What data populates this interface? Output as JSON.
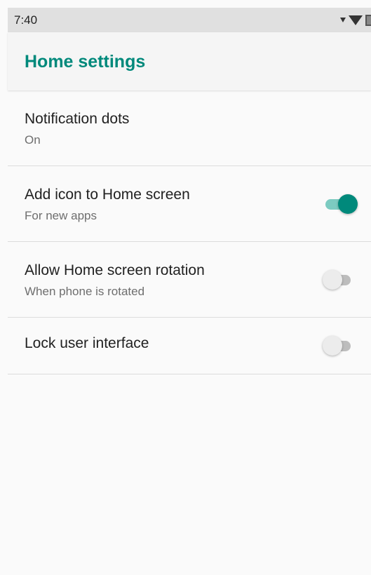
{
  "status_bar": {
    "time": "7:40",
    "icons": [
      "signal-icon",
      "wifi-icon",
      "battery-icon"
    ]
  },
  "app_bar": {
    "title": "Home settings"
  },
  "settings": [
    {
      "title": "Notification dots",
      "summary": "On"
    },
    {
      "title": "Add icon to Home screen",
      "summary": "For new apps",
      "toggle": true
    },
    {
      "title": "Allow Home screen rotation",
      "summary": "When phone is rotated",
      "toggle": false
    },
    {
      "title": "Lock user interface",
      "toggle": false
    }
  ],
  "colors": {
    "accent": "#00897b",
    "track_on": "#7ccbc1",
    "track_off": "#bdbdbd",
    "thumb_off": "#ececec"
  }
}
